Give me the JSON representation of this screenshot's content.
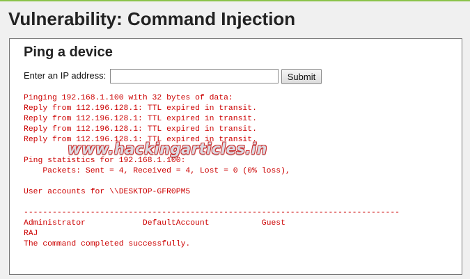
{
  "page": {
    "title": "Vulnerability: Command Injection"
  },
  "panel": {
    "title": "Ping a device",
    "ip_label": "Enter an IP address:",
    "ip_value": "",
    "submit_label": "Submit"
  },
  "output": {
    "lines": [
      "Pinging 192.168.1.100 with 32 bytes of data:",
      "Reply from 112.196.128.1: TTL expired in transit.",
      "Reply from 112.196.128.1: TTL expired in transit.",
      "Reply from 112.196.128.1: TTL expired in transit.",
      "Reply from 112.196.128.1: TTL expired in transit.",
      "",
      "Ping statistics for 192.168.1.100:",
      "    Packets: Sent = 4, Received = 4, Lost = 0 (0% loss),",
      "",
      "User accounts for \\\\DESKTOP-GFR0PM5",
      "",
      "-------------------------------------------------------------------------------",
      "Administrator            DefaultAccount           Guest",
      "RAJ",
      "The command completed successfully."
    ]
  },
  "watermark": {
    "text": "www.hackingarticles.in"
  },
  "colors": {
    "accent_top_border": "#8bc34a",
    "output_text": "#cc0000",
    "background": "#f0f0f0",
    "panel_background": "#ffffff"
  }
}
